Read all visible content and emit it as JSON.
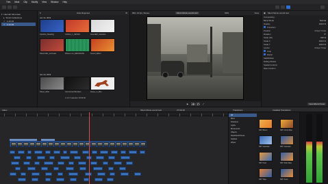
{
  "menubar": {
    "apple": "",
    "items": [
      "Trim",
      "Mark",
      "Clip",
      "Modify",
      "View",
      "Window",
      "Help"
    ]
  },
  "libraries": {
    "items": [
      {
        "label": "Hannah Simonsen",
        "selected": false
      },
      {
        "label": "Smart Collections",
        "selected": false
      },
      {
        "label": "1-10-19",
        "selected": false
      },
      {
        "label": "1-14-19",
        "selected": true
      }
    ]
  },
  "browser": {
    "filter": "Hide Rejected",
    "groups": [
      {
        "date": "Jan 14, 2019",
        "clips": [
          "Caroline_Reading",
          "Clothes_1_JESSIC",
          "SoundEff_Cassette"
        ]
      },
      {
        "date": "",
        "clips": [
          "Sheet Maz_Acrimate",
          "Waves mix_RESONATE",
          "Sound_Effect"
        ]
      },
      {
        "date": "Jan 10, 2019",
        "clips": [
          "Sheet_ofthe",
          "Cat Animal Wonders",
          "Horse_in_Mot.."
        ]
      }
    ],
    "status": "1 of 17 selected, 25:06:00"
  },
  "viewer": {
    "format": "960, 24 fps, Stereo",
    "clip_title": "Silent Movie sound test",
    "zoom": "90%",
    "view_menu": "View",
    "timecode": "38:15"
  },
  "inspector": {
    "title": "Silent Movie sound test",
    "sections": [
      {
        "label": "Compositing",
        "value": ""
      },
      {
        "label": "Blend Mode",
        "value": "Normal"
      },
      {
        "label": "Opacity",
        "value": "100.0 %"
      },
      {
        "label": "Transform",
        "value": ""
      },
      {
        "label": "Position",
        "value": "X 0 px  Y 0 px"
      },
      {
        "label": "Rotation",
        "value": "0°"
      },
      {
        "label": "Scale (All)",
        "value": "100 %"
      },
      {
        "label": "Scale X",
        "value": "100.0 %"
      },
      {
        "label": "Scale Y",
        "value": "100.0 %"
      },
      {
        "label": "Anchor",
        "value": "X 0 px  Y 0 px"
      },
      {
        "label": "Crop",
        "value": ""
      },
      {
        "label": "Distort",
        "value": ""
      },
      {
        "label": "Stabilization",
        "value": ""
      },
      {
        "label": "Rolling Shutter",
        "value": ""
      },
      {
        "label": "Spatial Conform",
        "value": ""
      },
      {
        "label": "Rate Conform",
        "value": ""
      }
    ],
    "save_preset": "Save Effects Preset"
  },
  "timeline": {
    "label": "Index",
    "project": "Silent Movie sound test",
    "duration": "27:00:18"
  },
  "transitions": {
    "title": "Transitions",
    "header": "Installed Transitions",
    "categories": [
      "All",
      "Blurs",
      "Dissolves",
      "Lights",
      "Movements",
      "Objects",
      "Replicator/Clones",
      "Stylized",
      "Wipes"
    ],
    "thumbs": [
      {
        "label": "360° Bloom"
      },
      {
        "label": "360° Circle Wipe"
      },
      {
        "label": "360° Gaussian"
      },
      {
        "label": "360° Gaussian"
      },
      {
        "label": "360° Push"
      },
      {
        "label": "360° Slide Wipe"
      },
      {
        "label": "360° Wipe"
      },
      {
        "label": "360° Zoom"
      }
    ]
  },
  "meters": {
    "left_level": 0.6,
    "right_level": 0.6
  },
  "colors": {
    "accent": "#3a5a8c",
    "playhead": "#e34b4b",
    "clip": "#2f5ea8"
  }
}
